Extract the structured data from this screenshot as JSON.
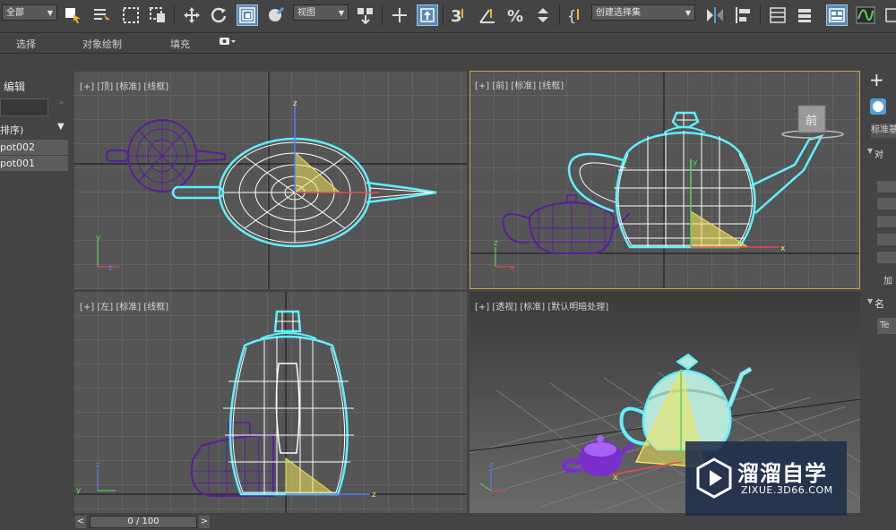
{
  "toolbar": {
    "selection_filter": "全部",
    "reference_coord": "视图",
    "named_selection": "创建选择集"
  },
  "ribbon": {
    "tab_select": "选择",
    "tab_object_paint": "对象绘制",
    "tab_populate": "填充"
  },
  "scene_explorer": {
    "header": "编辑",
    "sort_label": "排序)",
    "items": [
      "pot002",
      "pot001"
    ]
  },
  "viewports": {
    "top": "[+] [顶] [标准] [线框]",
    "front": "[+] [前] [标准] [线框]",
    "left": "[+] [左] [标准] [线框]",
    "perspective": "[+] [透视] [标准] [默认明暗处理]",
    "viewcube_front": "前"
  },
  "command_panel": {
    "standard_primitives": "标准基",
    "object_type": "对",
    "add": "加",
    "name_and_color": "名",
    "name_value": "Te"
  },
  "timeline": {
    "frame_label": "0 / 100",
    "prev": "<",
    "next": ">"
  },
  "watermark": {
    "brand": "溜溜自学",
    "url": "ZIXUE.3D66.COM"
  },
  "colors": {
    "viewport_bg": "#555555",
    "active_border": "#c8a94b",
    "selection_wire": "#5ff0ff",
    "unselected_wire": "#5a1e9a",
    "gizmo_yellow": "#f2e35a"
  }
}
